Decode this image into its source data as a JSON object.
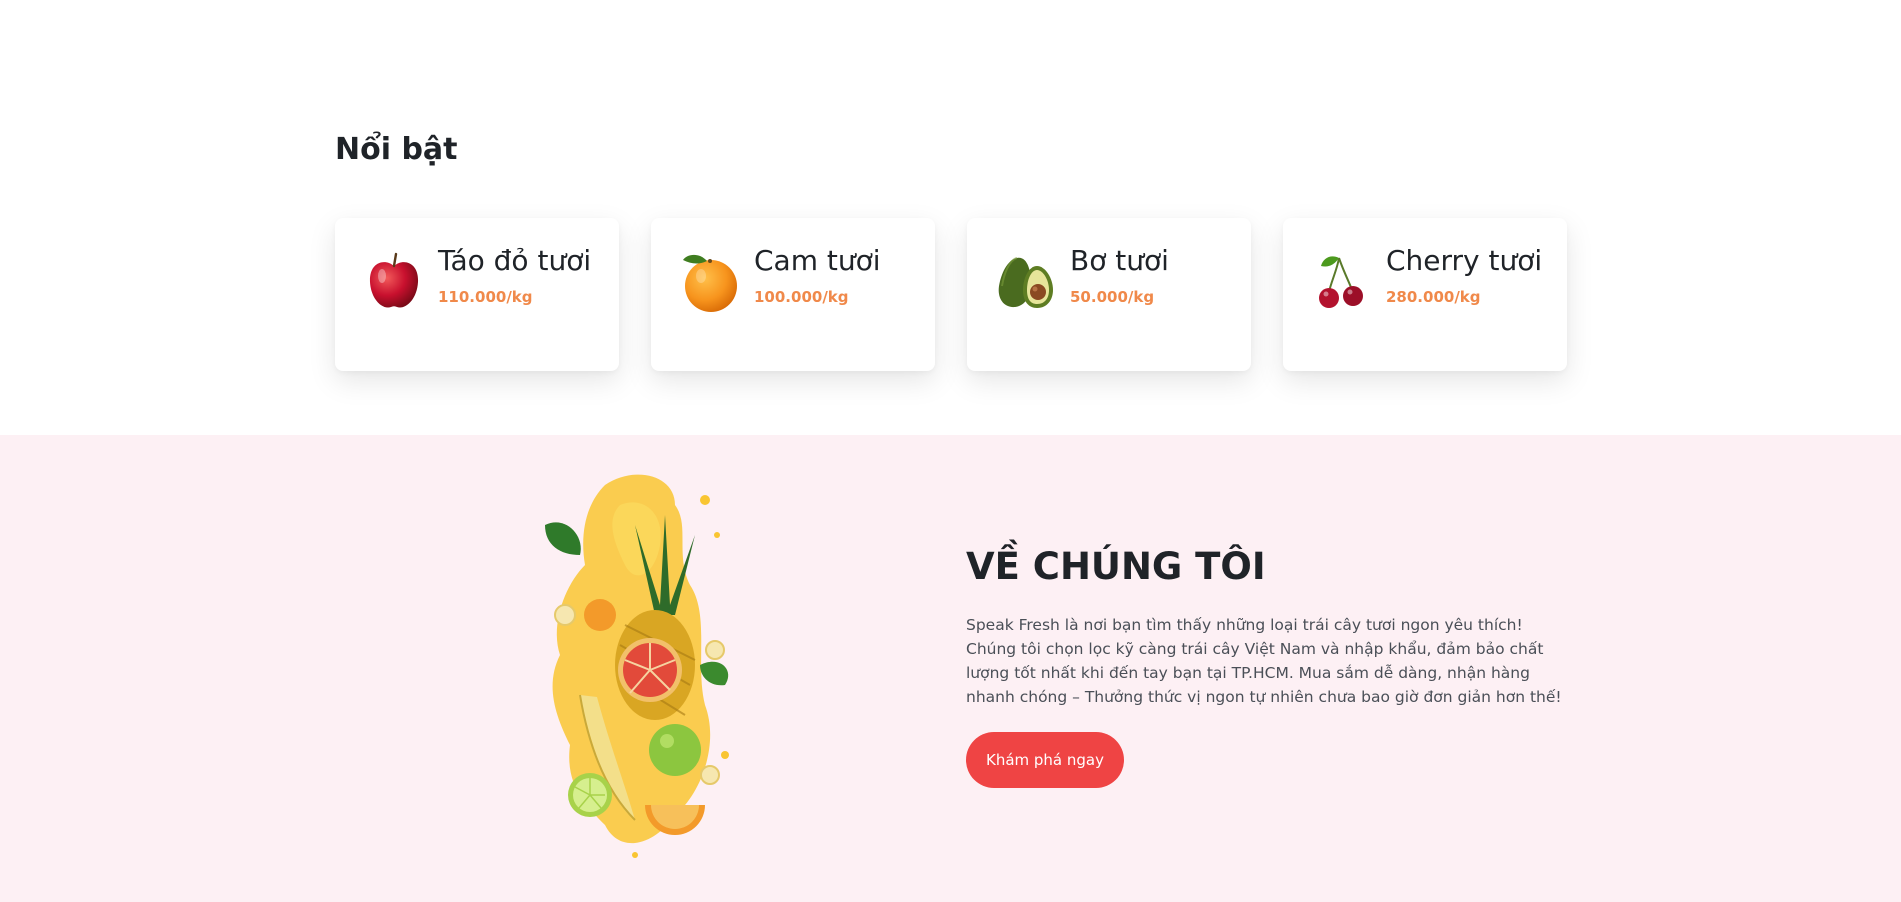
{
  "featured": {
    "title": "Nổi bật",
    "products": [
      {
        "name": "Táo đỏ tươi",
        "price": "110.000/kg",
        "icon": "red-apple-icon"
      },
      {
        "name": "Cam tươi",
        "price": "100.000/kg",
        "icon": "orange-icon"
      },
      {
        "name": "Bơ tươi",
        "price": "50.000/kg",
        "icon": "avocado-icon"
      },
      {
        "name": "Cherry tươi",
        "price": "280.000/kg",
        "icon": "cherry-icon"
      }
    ]
  },
  "about": {
    "title": "VỀ CHÚNG TÔI",
    "text": "Speak Fresh là nơi bạn tìm thấy những loại trái cây tươi ngon yêu thích! Chúng tôi chọn lọc kỹ càng trái cây Việt Nam và nhập khẩu, đảm bảo chất lượng tốt nhất khi đến tay bạn tại TP.HCM. Mua sắm dễ dàng, nhận hàng nhanh chóng – Thưởng thức vị ngon tự nhiên chưa bao giờ đơn giản hơn thế!",
    "button_label": "Khám phá ngay",
    "image": "fruit-juice-splash-image"
  },
  "colors": {
    "price": "#f0894a",
    "button": "#ef4444",
    "about_bg": "#fdf0f4",
    "heading": "#1f2328"
  }
}
